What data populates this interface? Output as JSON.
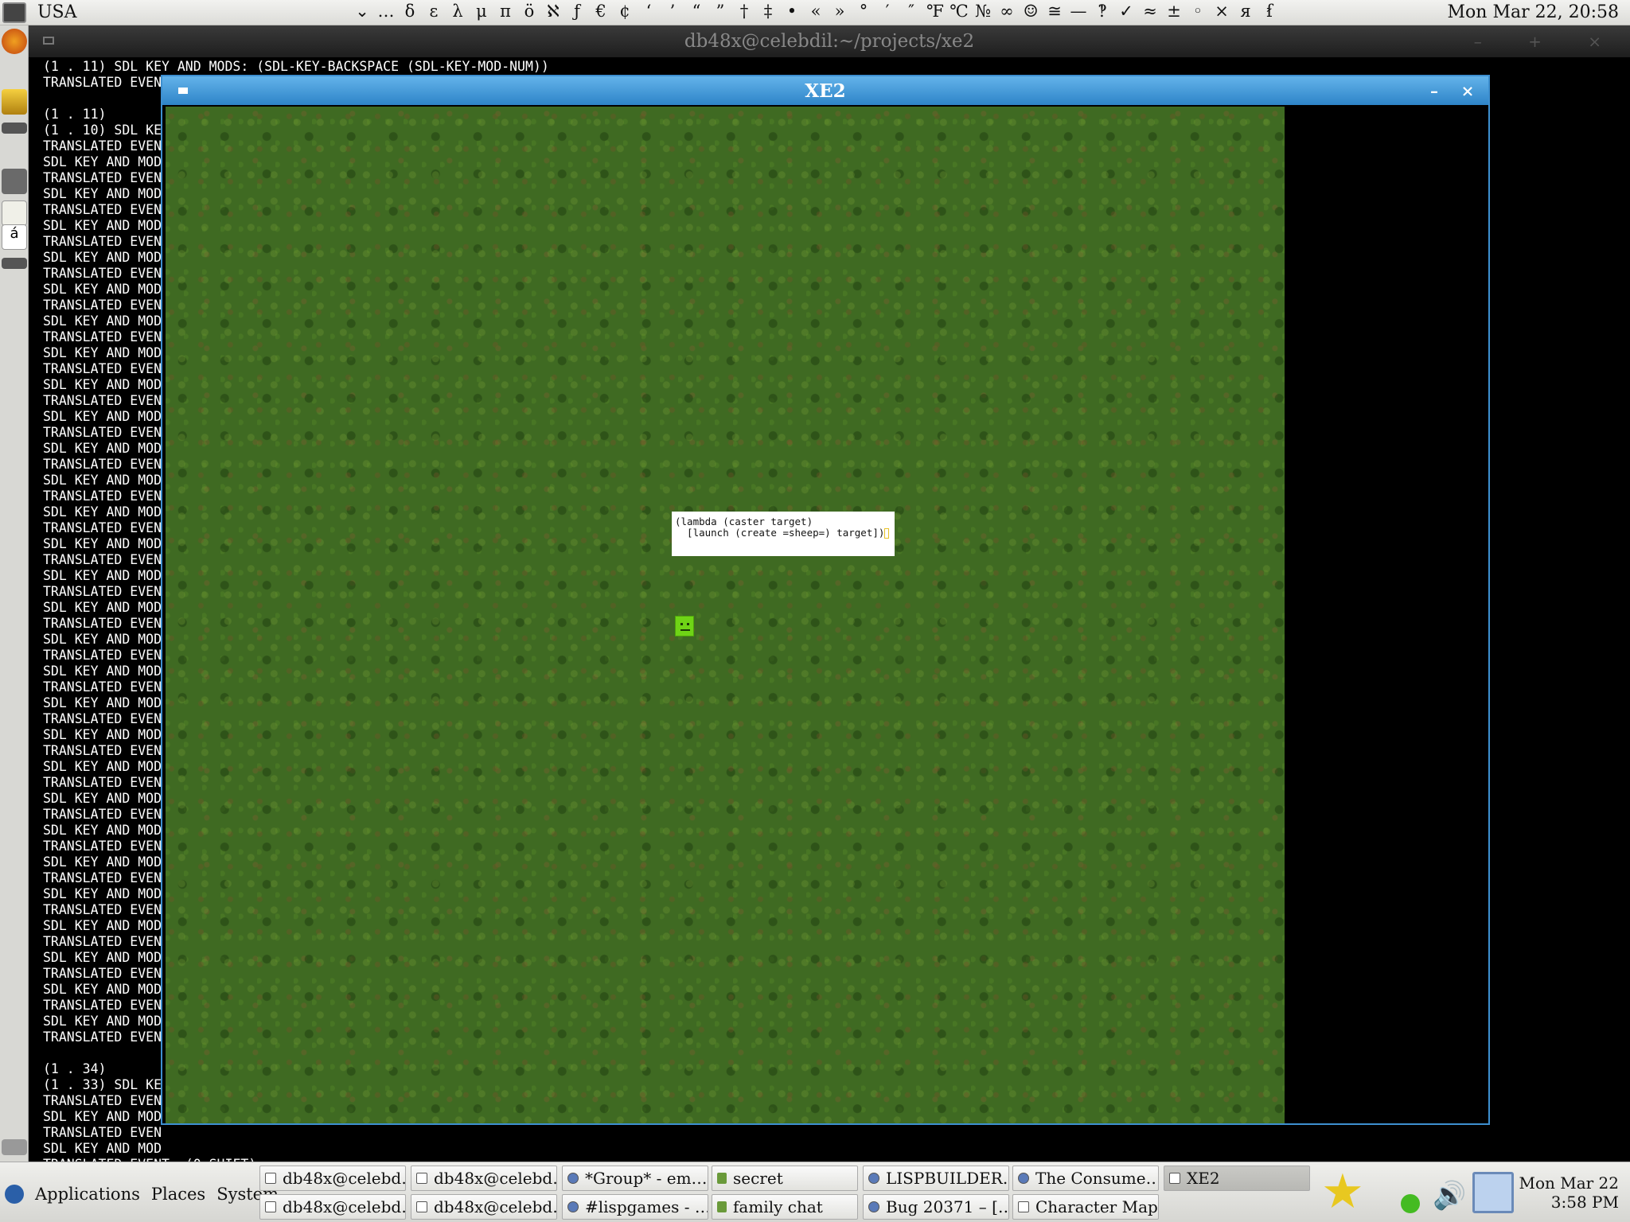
{
  "top_panel": {
    "keyboard_layout": "USA",
    "special_chars": [
      "⌄",
      "…",
      "δ",
      "ε",
      "λ",
      "μ",
      "π",
      "ö",
      "ℵ",
      "ƒ",
      "€",
      "¢",
      "‘",
      "’",
      "“",
      "”",
      "†",
      "‡",
      "•",
      "«",
      "»",
      "°",
      "′",
      "″",
      "℉",
      "℃",
      "№",
      "∞",
      "☺",
      "≅",
      "—",
      "‽",
      "✓",
      "≈",
      "±",
      "◦",
      "×",
      "я",
      "ẜ"
    ],
    "clock": "Mon Mar 22, 20:58"
  },
  "terminal": {
    "title": "db48x@celebdil:~/projects/xe2",
    "lines": [
      "(1 . 11) SDL KEY AND MODS: (SDL-KEY-BACKSPACE (SDL-KEY-MOD-NUM))",
      "TRANSLATED EVEN",
      "",
      "(1 . 11)",
      "(1 . 10) SDL KE",
      "TRANSLATED EVEN",
      "SDL KEY AND MOD",
      "TRANSLATED EVEN",
      "SDL KEY AND MOD",
      "TRANSLATED EVEN",
      "SDL KEY AND MOD",
      "TRANSLATED EVEN",
      "SDL KEY AND MOD",
      "TRANSLATED EVEN",
      "SDL KEY AND MOD",
      "TRANSLATED EVEN",
      "SDL KEY AND MOD",
      "TRANSLATED EVEN",
      "SDL KEY AND MOD",
      "TRANSLATED EVEN",
      "SDL KEY AND MOD",
      "TRANSLATED EVEN",
      "SDL KEY AND MOD",
      "TRANSLATED EVEN",
      "SDL KEY AND MOD",
      "TRANSLATED EVEN",
      "SDL KEY AND MOD",
      "TRANSLATED EVEN",
      "SDL KEY AND MOD",
      "TRANSLATED EVEN",
      "SDL KEY AND MOD",
      "TRANSLATED EVEN",
      "SDL KEY AND MOD",
      "TRANSLATED EVEN",
      "SDL KEY AND MOD",
      "TRANSLATED EVEN",
      "SDL KEY AND MOD",
      "TRANSLATED EVEN",
      "SDL KEY AND MOD",
      "TRANSLATED EVEN",
      "SDL KEY AND MOD",
      "TRANSLATED EVEN",
      "SDL KEY AND MOD",
      "TRANSLATED EVEN",
      "SDL KEY AND MOD",
      "TRANSLATED EVEN",
      "SDL KEY AND MOD",
      "TRANSLATED EVEN",
      "SDL KEY AND MOD",
      "TRANSLATED EVEN",
      "SDL KEY AND MOD",
      "TRANSLATED EVEN",
      "SDL KEY AND MOD",
      "TRANSLATED EVEN",
      "SDL KEY AND MOD",
      "TRANSLATED EVEN",
      "SDL KEY AND MOD",
      "TRANSLATED EVEN",
      "SDL KEY AND MOD",
      "TRANSLATED EVEN",
      "SDL KEY AND MOD",
      "TRANSLATED EVEN",
      "",
      "(1 . 34)",
      "(1 . 33) SDL KE",
      "TRANSLATED EVEN",
      "SDL KEY AND MOD",
      "TRANSLATED EVEN",
      "SDL KEY AND MOD",
      "TRANSLATED EVENT: (0 SHIFT)"
    ]
  },
  "xe2": {
    "title": "XE2",
    "minimize": "–",
    "close": "×",
    "code_line1": "(lambda (caster target)",
    "code_line2": "  [launch (create =sheep=) target])"
  },
  "taskbar": {
    "menus": [
      "Applications",
      "Places",
      "System"
    ],
    "tasks_row1": [
      {
        "label": "db48x@celebd…",
        "icon": "terminal-icon"
      },
      {
        "label": "db48x@celebd…",
        "icon": "terminal-icon"
      },
      {
        "label": "*Group* - em…",
        "icon": "browser-icon"
      },
      {
        "label": "secret",
        "icon": "chat-icon"
      },
      {
        "label": "LISPBUILDER…",
        "icon": "browser-icon"
      },
      {
        "label": "The Consume…",
        "icon": "browser-icon"
      },
      {
        "label": "XE2",
        "icon": "window-icon"
      }
    ],
    "tasks_row2": [
      {
        "label": "db48x@celebd…",
        "icon": "terminal-icon"
      },
      {
        "label": "db48x@celebd…",
        "icon": "terminal-icon"
      },
      {
        "label": "#lispgames - …",
        "icon": "browser-icon"
      },
      {
        "label": "family chat",
        "icon": "chat-icon"
      },
      {
        "label": "Bug 20371 – […",
        "icon": "browser-icon"
      },
      {
        "label": "Character Map",
        "icon": "charmap-icon"
      }
    ],
    "clock_date": "Mon Mar 22",
    "clock_time": "3:58 PM"
  }
}
